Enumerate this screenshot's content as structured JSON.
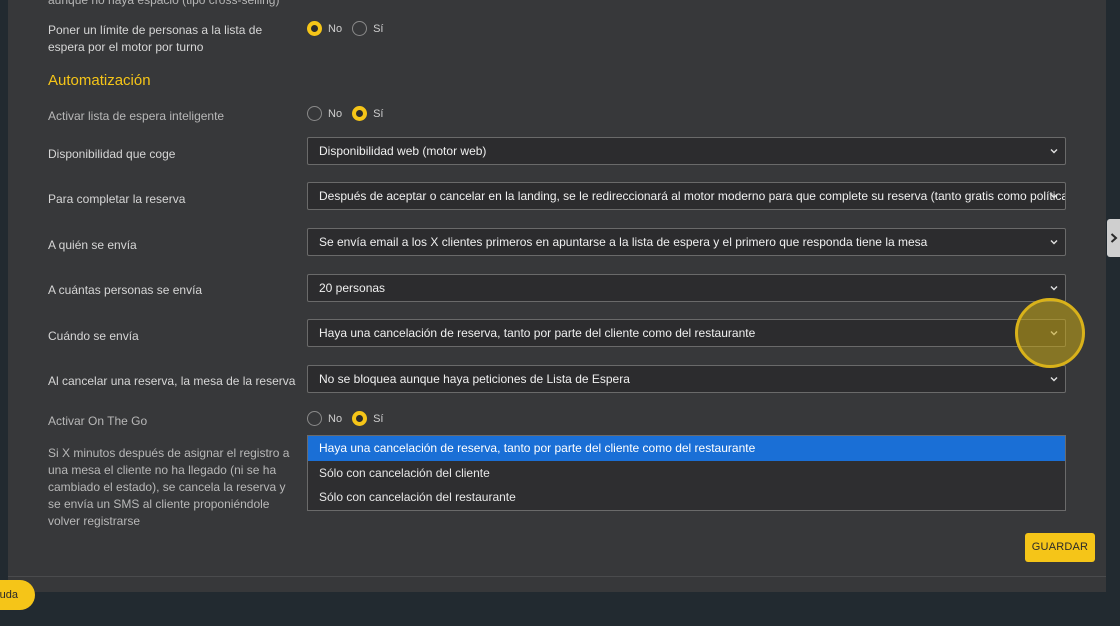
{
  "top_cut_text": "aunque no haya espacio (tipo cross-selling)",
  "waitlist_limit": {
    "label": "Poner un límite de personas a la lista de espera por el motor por turno",
    "options": [
      "No",
      "Sí"
    ],
    "selected": "No"
  },
  "section_title": "Automatización",
  "smart_waitlist": {
    "label": "Activar lista de espera inteligente",
    "options": [
      "No",
      "Sí"
    ],
    "selected": "Sí"
  },
  "fields": [
    {
      "label": "Disponibilidad que coge",
      "value": "Disponibilidad web (motor web)"
    },
    {
      "label": "Para completar la reserva",
      "value": "Después de aceptar o cancelar en la landing, se le redireccionará al motor moderno para que complete su reserva (tanto gratis como política y"
    },
    {
      "label": "A quién se envía",
      "value": "Se envía email a los X clientes primeros en apuntarse a la lista de espera y el primero que responda tiene la mesa"
    },
    {
      "label": "A cuántas personas se envía",
      "value": "20 personas"
    },
    {
      "label": "Cuándo se envía",
      "value": "Haya una cancelación de reserva, tanto por parte del cliente como del restaurante"
    },
    {
      "label": "Al cancelar una reserva, la mesa de la reserva",
      "value": "No se bloquea aunque haya peticiones de Lista de Espera"
    }
  ],
  "on_the_go": {
    "label": "Activar On The Go",
    "options": [
      "No",
      "Sí"
    ],
    "selected": "Sí"
  },
  "on_the_go_description": "Si X minutos después de asignar el registro a una mesa el cliente no ha llegado (ni se ha cambiado el estado), se cancela la reserva y se envía un SMS al cliente proponiéndole volver registrarse",
  "dropdown_options": [
    "Haya una cancelación de reserva, tanto por parte del cliente como del restaurante",
    "Sólo con cancelación del cliente",
    "Sólo con cancelación del restaurante"
  ],
  "save_button": "GUARDAR",
  "help_button": "uda",
  "colors": {
    "accent": "#f5c518",
    "panel": "#37383a",
    "background": "#222a30",
    "dropdown_highlight": "#1a6fd6"
  },
  "icons": {
    "select_arrow": "chevron-down-icon",
    "side_tab": "chevron-right-icon"
  }
}
